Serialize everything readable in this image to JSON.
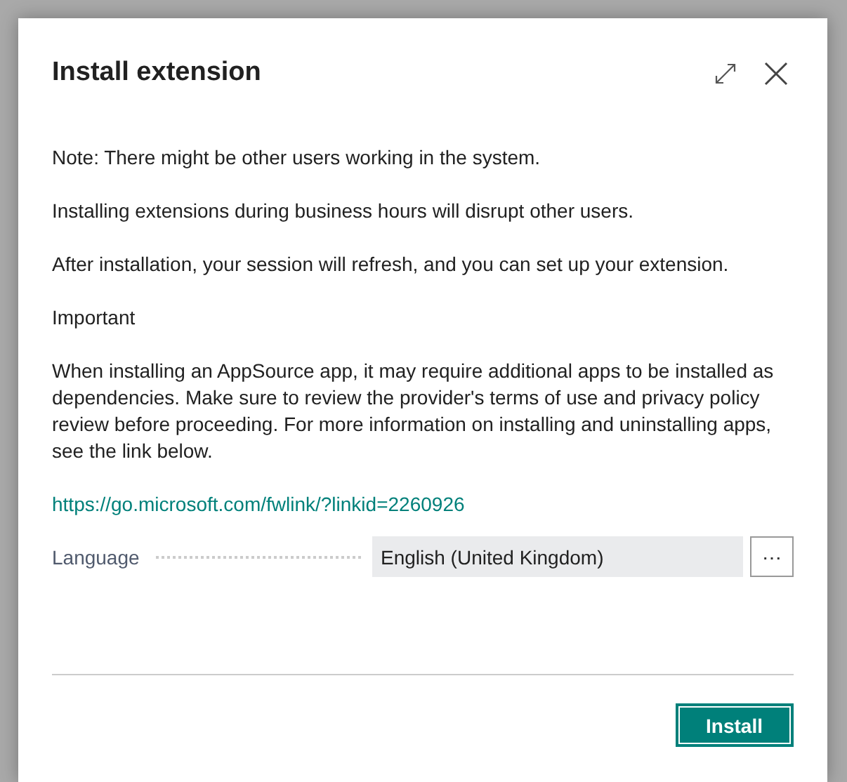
{
  "dialog": {
    "title": "Install extension",
    "paragraphs": [
      "Note: There might be other users working in the system.",
      "Installing extensions during business hours will disrupt other users.",
      "After installation, your session will refresh, and you can set up your extension.",
      "Important",
      "When installing an AppSource app, it may require additional apps to be installed as dependencies. Make sure to review the provider's terms of use and privacy policy review before proceeding. For more information on installing and uninstalling apps, see the link below."
    ],
    "link": "https://go.microsoft.com/fwlink/?linkid=2260926",
    "field": {
      "label": "Language",
      "value": "English (United Kingdom)",
      "lookup": "⋯"
    },
    "buttons": [
      "Install"
    ]
  }
}
